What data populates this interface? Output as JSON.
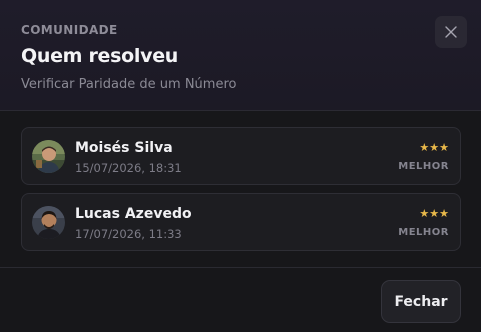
{
  "header": {
    "eyebrow": "COMUNIDADE",
    "title": "Quem resolveu",
    "subtitle": "Verificar Paridade de um Número",
    "close_icon": "close-icon"
  },
  "solvers": [
    {
      "name": "Moisés Silva",
      "date": "15/07/2026, 18:31",
      "stars": "★★★",
      "rank": "MELHOR"
    },
    {
      "name": "Lucas Azevedo",
      "date": "17/07/2026, 11:33",
      "stars": "★★★",
      "rank": "MELHOR"
    }
  ],
  "footer": {
    "close_label": "Fechar"
  },
  "colors": {
    "star": "#e8b84a",
    "background": "#17171a",
    "card": "#1d1d21"
  }
}
